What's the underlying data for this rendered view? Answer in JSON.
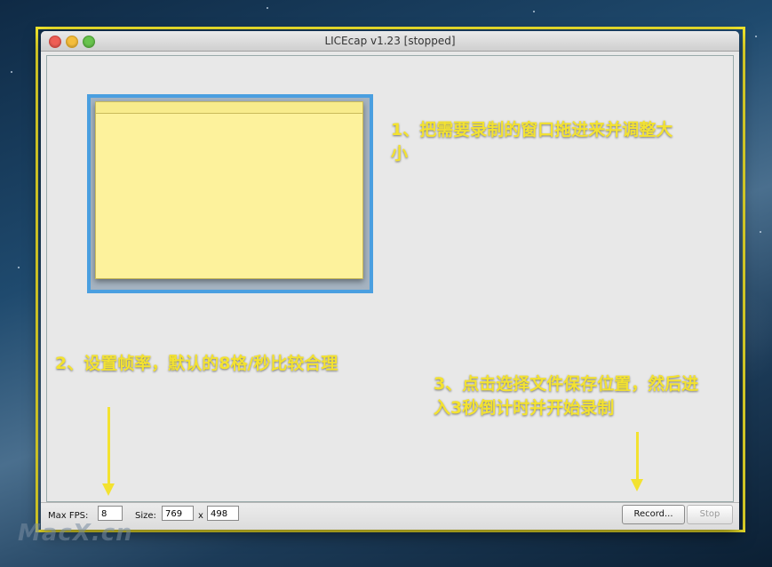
{
  "window": {
    "title": "LICEcap v1.23 [stopped]"
  },
  "annotations": {
    "step1": "1、把需要录制的窗口拖进来并调整大小",
    "step2": "2、设置帧率，默认的8格/秒比较合理",
    "step3": "3、点击选择文件保存位置，然后进入3秒倒计时并开始录制"
  },
  "toolbar": {
    "fps_label": "Max FPS:",
    "fps_value": "8",
    "size_label": "Size:",
    "width_value": "769",
    "x_label": "x",
    "height_value": "498",
    "record_label": "Record...",
    "stop_label": "Stop"
  },
  "watermark": "MacX.cn",
  "colors": {
    "annotation_yellow": "#f3e230",
    "frame_yellow": "#f2e62c",
    "selection_blue": "#4a9fe0",
    "sticky_note": "#fdf29c"
  }
}
